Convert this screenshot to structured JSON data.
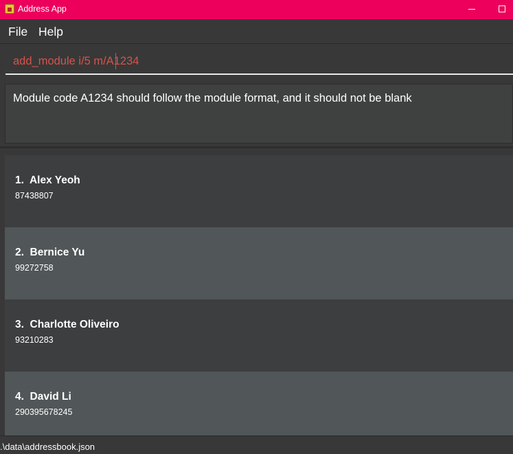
{
  "window": {
    "title": "Address App",
    "minimize_icon": "minimize-icon",
    "maximize_icon": "maximize-icon"
  },
  "menu": {
    "file": "File",
    "help": "Help"
  },
  "command": {
    "value": "add_module i/5 m/A1234"
  },
  "result": {
    "message": "Module code A1234 should follow the module format, and it should not be blank"
  },
  "persons": [
    {
      "name": "1.  Alex Yeoh",
      "phone": "87438807"
    },
    {
      "name": "2.  Bernice Yu",
      "phone": "99272758"
    },
    {
      "name": "3.  Charlotte Oliveiro",
      "phone": "93210283"
    },
    {
      "name": "4.  David Li",
      "phone": "290395678245"
    }
  ],
  "status": {
    "path": ".\\data\\addressbook.json"
  },
  "colors": {
    "titlebar": "#ec005c",
    "background": "#383838",
    "card_odd": "#3c3e3f",
    "card_even": "#515658",
    "error_text": "#d6534a"
  }
}
